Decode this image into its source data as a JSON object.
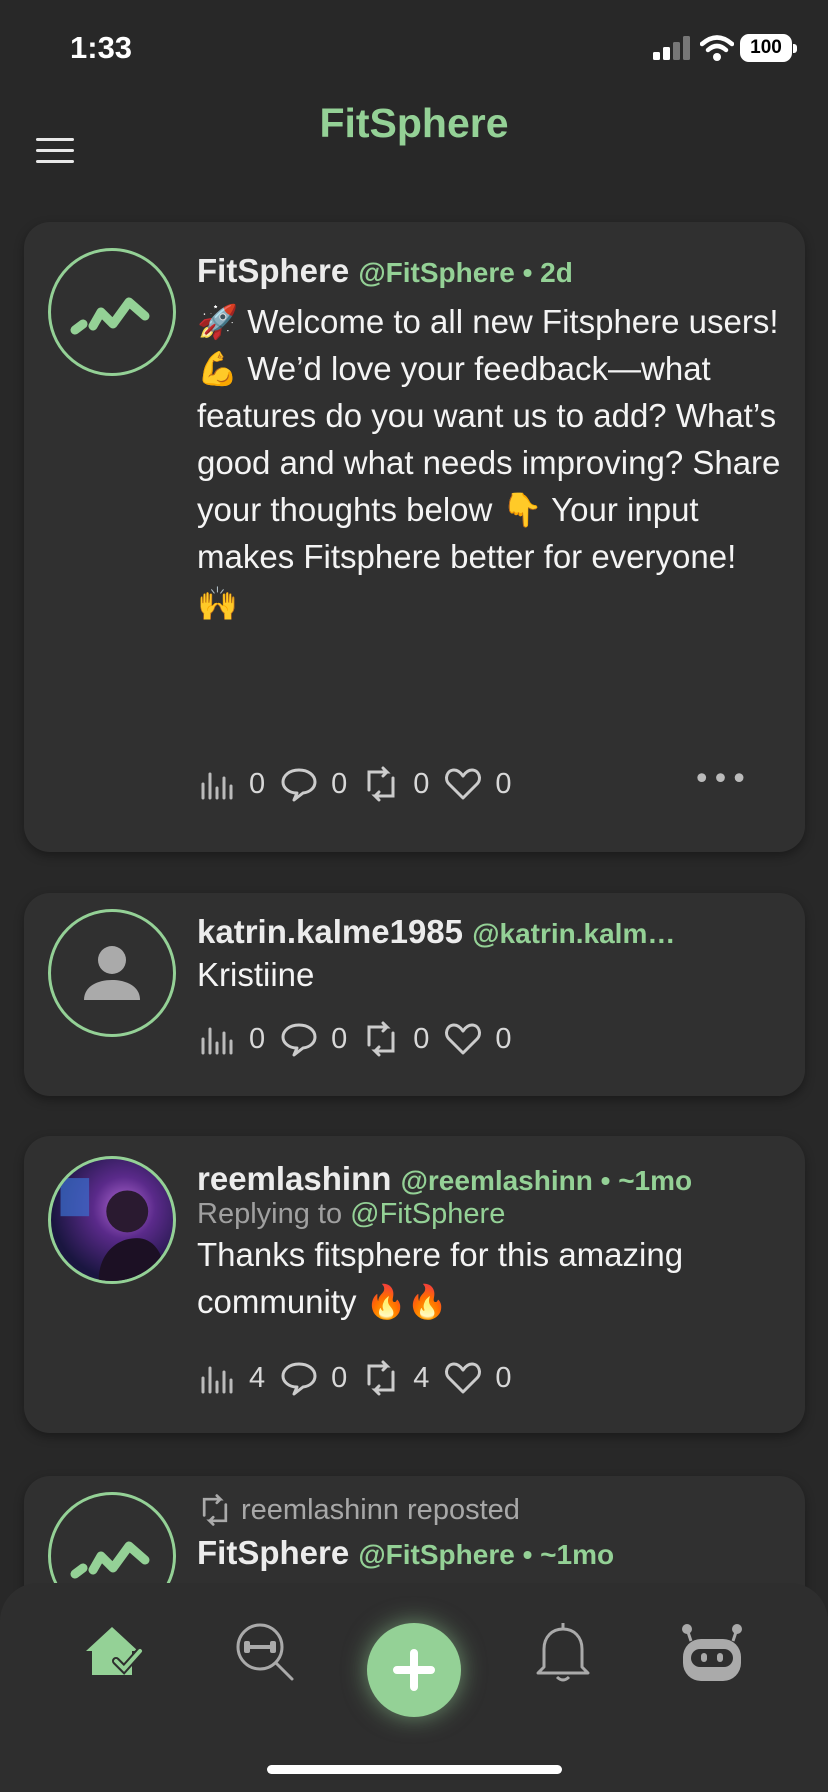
{
  "status_bar": {
    "time": "1:33",
    "battery": "100"
  },
  "app": {
    "title": "FitSphere",
    "accent": "#94d196"
  },
  "posts": [
    {
      "name": "FitSphere",
      "handle": "@FitSphere • 2d",
      "text": "🚀 Welcome to all new Fitsphere users! 💪 We’d love your feedback—what features do you want us to add? What’s good and what needs improving? Share your thoughts below 👇 Your input makes Fitsphere better for everyone! 🙌",
      "stats": {
        "views": "0",
        "comments": "0",
        "reposts": "0",
        "likes": "0"
      }
    },
    {
      "name": "katrin.kalme1985",
      "handle": "@katrin.kalm…",
      "text": "Kristiine",
      "stats": {
        "views": "0",
        "comments": "0",
        "reposts": "0",
        "likes": "0"
      }
    },
    {
      "name": "reemlashinn",
      "handle": "@reemlashinn • ~1mo",
      "reply_prefix": "Replying to",
      "reply_handle": "@FitSphere",
      "text": "Thanks fitsphere for this amazing community 🔥🔥",
      "stats": {
        "views": "4",
        "comments": "0",
        "reposts": "4",
        "likes": "0"
      }
    },
    {
      "repost_label": "reemlashinn reposted",
      "name": "FitSphere",
      "handle": "@FitSphere • ~1mo"
    }
  ],
  "nav": {
    "items": [
      "home-icon",
      "workout-search-icon",
      "add-icon",
      "bell-icon",
      "robot-icon"
    ]
  }
}
